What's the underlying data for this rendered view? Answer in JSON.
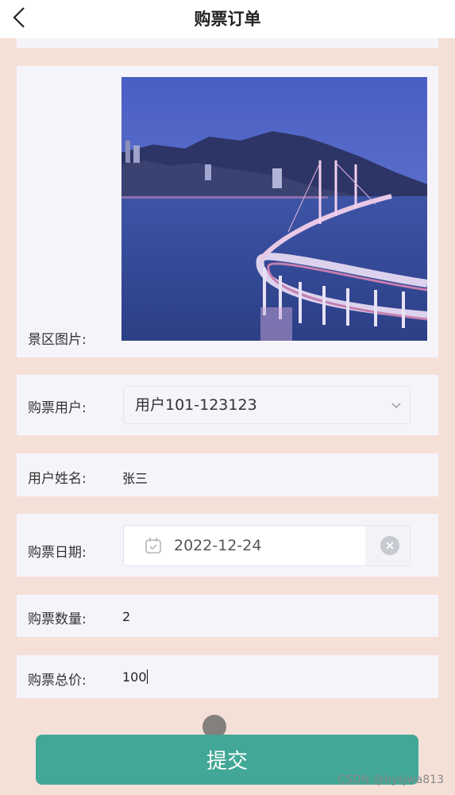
{
  "header": {
    "title": "购票订单",
    "back_icon": "chevron-left-icon"
  },
  "form": {
    "scenic_image": {
      "label": "景区图片:"
    },
    "buyer": {
      "label": "购票用户:",
      "value": "用户101-123123",
      "icon": "chevron-down-icon"
    },
    "user_name": {
      "label": "用户姓名:",
      "value": "张三"
    },
    "date": {
      "label": "购票日期:",
      "value": "2022-12-24",
      "icon": "calendar-icon",
      "clear_icon": "close-circle-icon"
    },
    "quantity": {
      "label": "购票数量:",
      "value": "2"
    },
    "total": {
      "label": "购票总价:",
      "value": "100"
    }
  },
  "submit_label": "提交",
  "watermark": "CSDN @bysjwa813",
  "colors": {
    "background": "#f5e0d8",
    "card": "#f6f4fb",
    "submit": "#42a796"
  }
}
